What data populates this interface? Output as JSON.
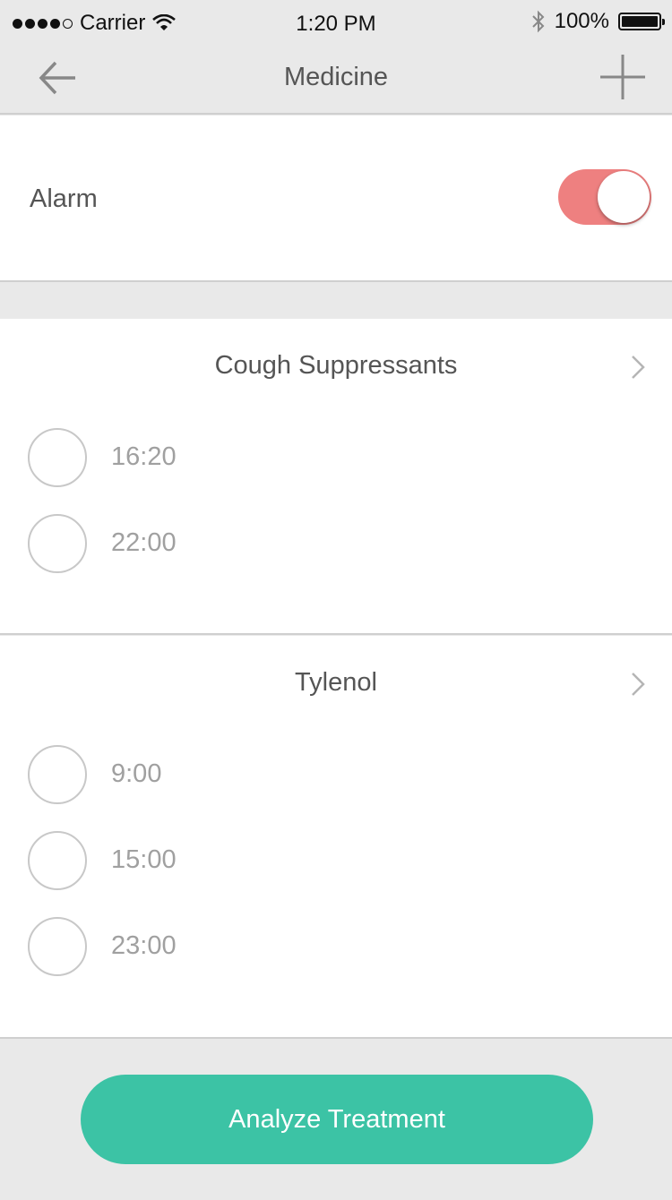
{
  "status_bar": {
    "carrier": "Carrier",
    "time": "1:20 PM",
    "battery": "100%",
    "signal_bars_filled": 4,
    "signal_bars_total": 5
  },
  "nav": {
    "title": "Medicine",
    "back_icon": "arrow-left-icon",
    "add_icon": "plus-icon"
  },
  "alarm": {
    "label": "Alarm",
    "enabled": true
  },
  "medicines": [
    {
      "name": "Cough Suppressants",
      "times": [
        "16:20",
        "22:00"
      ]
    },
    {
      "name": "Tylenol",
      "times": [
        "9:00",
        "15:00",
        "23:00"
      ]
    }
  ],
  "actions": {
    "analyze_label": "Analyze Treatment"
  },
  "colors": {
    "toggle_on": "#ee8080",
    "primary_button": "#3cc3a5",
    "background": "#e9e9e9"
  }
}
